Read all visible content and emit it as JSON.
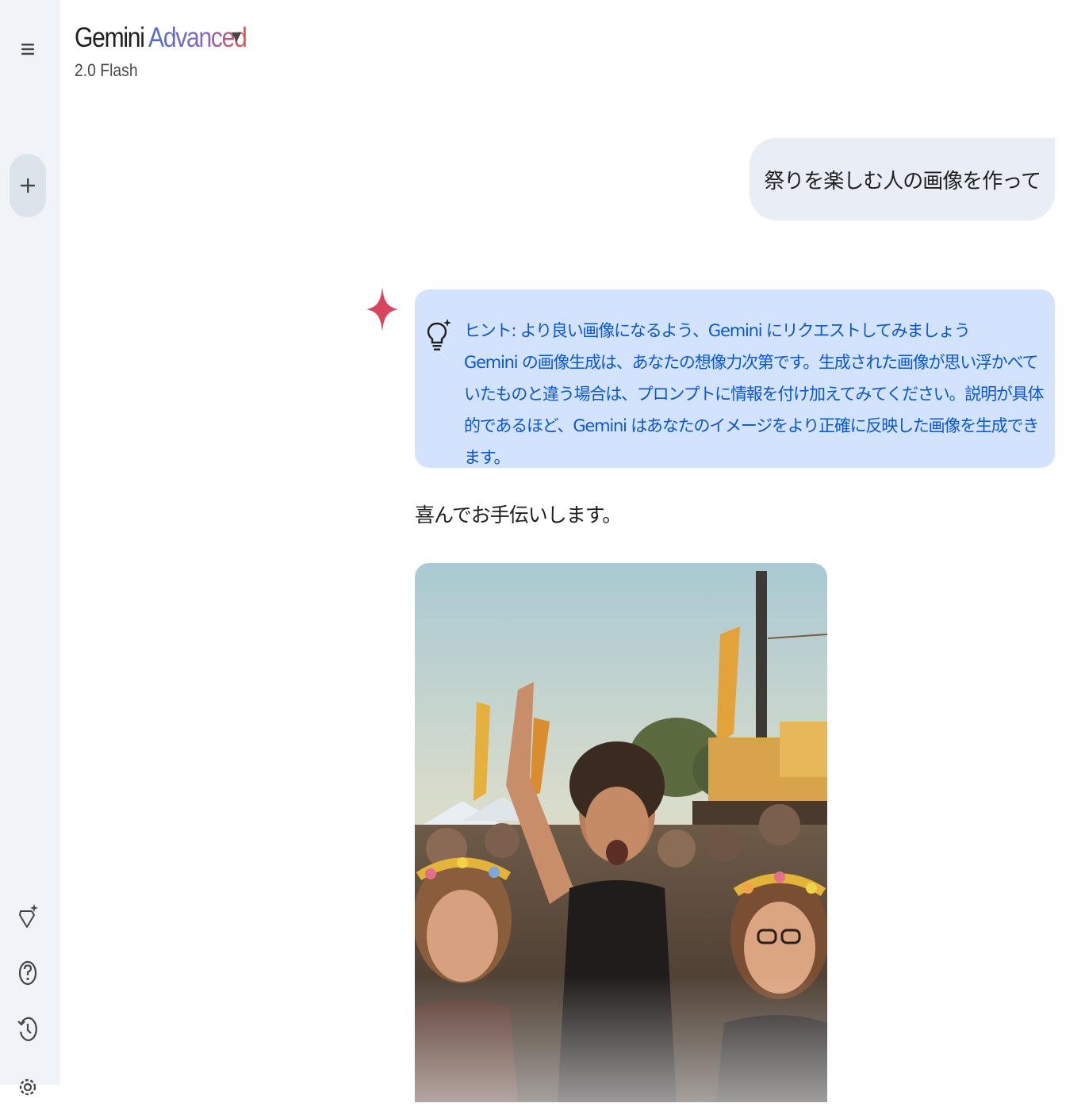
{
  "sidebar": {
    "menu_icon": "hamburger-menu-icon",
    "new_chat_icon": "plus-icon",
    "bottom_icons": [
      "gem-manager-icon",
      "help-icon",
      "activity-icon",
      "settings-icon"
    ]
  },
  "header": {
    "brand_main": "Gemini",
    "brand_tier": "Advanced",
    "model": "2.0 Flash"
  },
  "conversation": {
    "user_prompt": "祭りを楽しむ人の画像を作って",
    "tip": {
      "title": "ヒント: より良い画像になるよう、Gemini にリクエストしてみましょう",
      "body": "Gemini の画像生成は、あなたの想像力次第です。生成された画像が思い浮かべていたものと違う場合は、プロンプトに情報を付け加えてみてください。説明が具体的であるほど、Gemini はあなたのイメージをより正確に反映した画像を生成できます。"
    },
    "reply": "喜んでお手伝いします。"
  },
  "colors": {
    "rail_bg": "#f0f4f9",
    "user_bubble_bg": "#e9eef6",
    "tip_bg": "#d3e3fd",
    "tip_text": "#0b57d0",
    "spark": "#d9455f"
  }
}
